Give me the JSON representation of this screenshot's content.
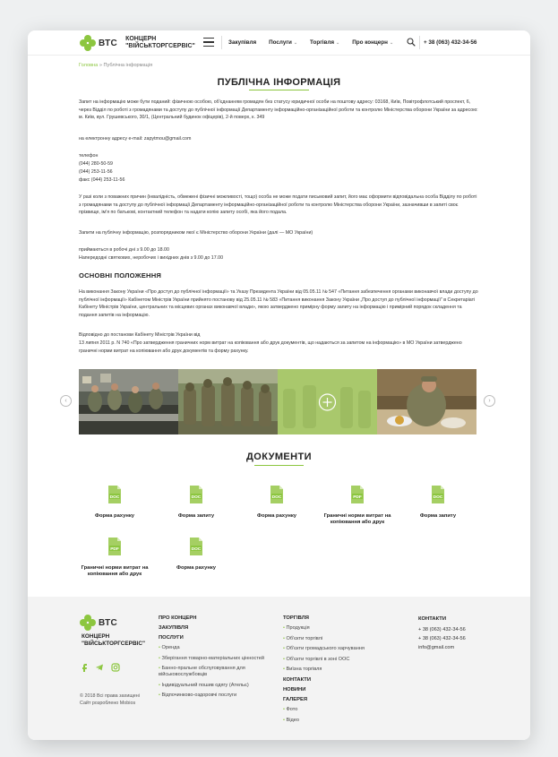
{
  "header": {
    "logo_abbr": "ВТС",
    "logo_line1": "КОНЦЕРН",
    "logo_line2": "\"ВІЙСЬКТОРГСЕРВІС\"",
    "nav": [
      "Закупівля",
      "Послуги",
      "Торгівля",
      "Про концерн"
    ],
    "phone": "+ 38 (063) 432-34-56"
  },
  "breadcrumb": {
    "home": "Головна",
    "sep": " » ",
    "current": "Публічна інформація"
  },
  "page_title": "ПУБЛІЧНА ІНФОРМАЦІЯ",
  "body": {
    "p1": "Запит на інформацію може бути поданий: фізичною особою, об'єднанням громадян без статусу юридичної особи на поштову адресу: 03168, Київ, Повітрофлотський проспект, 6, через Відділ по роботі з громадянами та доступу до публічної інформації Департаменту інформаційно-організаційної роботи та контролю Міністерства оборони України за адресою: м. Київ, вул. Грушевського, 30/1, (Центральний будинок офіцерів), 2-й поверх, к. 349",
    "p2": "на електронну адресу e-mail: zapytmou@gmail.com",
    "phone_label": "телефон",
    "phone1": "(044) 280-50-59",
    "phone2": "(044) 253-11-56",
    "fax": "факс (044) 253-11-56",
    "p3": "У разі коли з поважних причин (інвалідність, обмежені фізичні можливості, тощо) особа не може подати письмовий запит, його має оформити відповідальна особа Відділу по роботі з громадянами та доступу до публічної інформації Департаменту інформаційно-організаційної роботи та контролю Міністерства оборони України, зазначивши в запиті своє прізвище, ім'я по батькові, контактний телефон та надати копію запиту особі, яка його подала.",
    "p4": "Запити на публічну інформацію, розпорядником якої є Міністерство оборони України (далі — МО України)",
    "p5": "приймаються в робочі дні з 9.00 до 18.00",
    "p6": "Напередодні святкових, неробочих і вихідних днів з 9.00 до 17.00",
    "section_title": "ОСНОВНІ ПОЛОЖЕННЯ",
    "p7": "На виконання Закону України «Про доступ до публічної інформації» та Указу Президента України від 05.05.11 № 547 «Питання забезпечення органами виконавчої влади доступу до публічної інформації» Кабінетом Міністрів України прийнято постанову від 25.05.11 № 583 «Питання виконання Закону України „Про доступ до публічної інформації\" в Секретаріаті Кабінету Міністрів України, центральних та місцевих органах виконавчої влади», якою затверджено примірну форму запиту на інформацію і примірний порядок складення та подання запитів на інформацію.",
    "p8": "Відповідно до постанови Кабінету Міністрів України від",
    "p9": "13 липня 2011 р. N 740 «Про затвердження граничних норм витрат на копіювання або друк документів, що надаються за запитом на інформацію» в МО України затверджено граничні норми витрат на копіювання або друк документів та форму рахунку."
  },
  "gallery": {
    "prev": "‹",
    "next": "›",
    "zoom": "+"
  },
  "documents": {
    "title": "ДОКУМЕНТИ",
    "items": [
      {
        "type": "DOC",
        "name": "Форма рахунку"
      },
      {
        "type": "DOC",
        "name": "Форма запиту"
      },
      {
        "type": "DOC",
        "name": "Форма рахунку"
      },
      {
        "type": "PDF",
        "name": "Граничні норми витрат на копіювання або друк"
      },
      {
        "type": "DOC",
        "name": "Форма запиту"
      },
      {
        "type": "PDF",
        "name": "Граничні норми витрат на копіювання або друк"
      },
      {
        "type": "DOC",
        "name": "Форма рахунку"
      }
    ]
  },
  "footer": {
    "logo_abbr": "ВТС",
    "logo_line1": "КОНЦЕРН",
    "logo_line2": "\"ВІЙСЬКТОРГСЕРВІС\"",
    "copyright": "© 2018 Всі права захищені",
    "developer": "Сайт розроблено Mobios",
    "col1": {
      "about": "ПРО КОНЦЕРН",
      "purchases": "ЗАКУПІВЛЯ",
      "services": "ПОСЛУГИ",
      "items": [
        "Оренда",
        "Зберігання товарно-матеріальних цінностей",
        "Банно-пральне обслуговування для військовослужбовців",
        "Індивідуальний пошив одягу (Ательє)",
        "Відпочинково-оздоровчі послуги"
      ]
    },
    "col2": {
      "trade": "ТОРГІВЛЯ",
      "items": [
        "Продукція",
        "Об'єкти торгівлі",
        "Об'єкти громадського харчування",
        "Об'єкти торгівлі в зоні ООС",
        "Виїзна торгівля"
      ],
      "contacts": "КОНТАКТИ",
      "news": "НОВИНИ",
      "galleryh": "ГАЛЕРЕЯ",
      "gallery_items": [
        "Фото",
        "Відео"
      ]
    },
    "col3": {
      "contacts": "КОНТАКТИ",
      "phone1": "+ 38 (063) 432-34-56",
      "phone2": "+ 38 (063) 432-34-56",
      "email": "info@gmail.com"
    }
  },
  "colors": {
    "accent": "#8cc63f",
    "text": "#222222"
  }
}
